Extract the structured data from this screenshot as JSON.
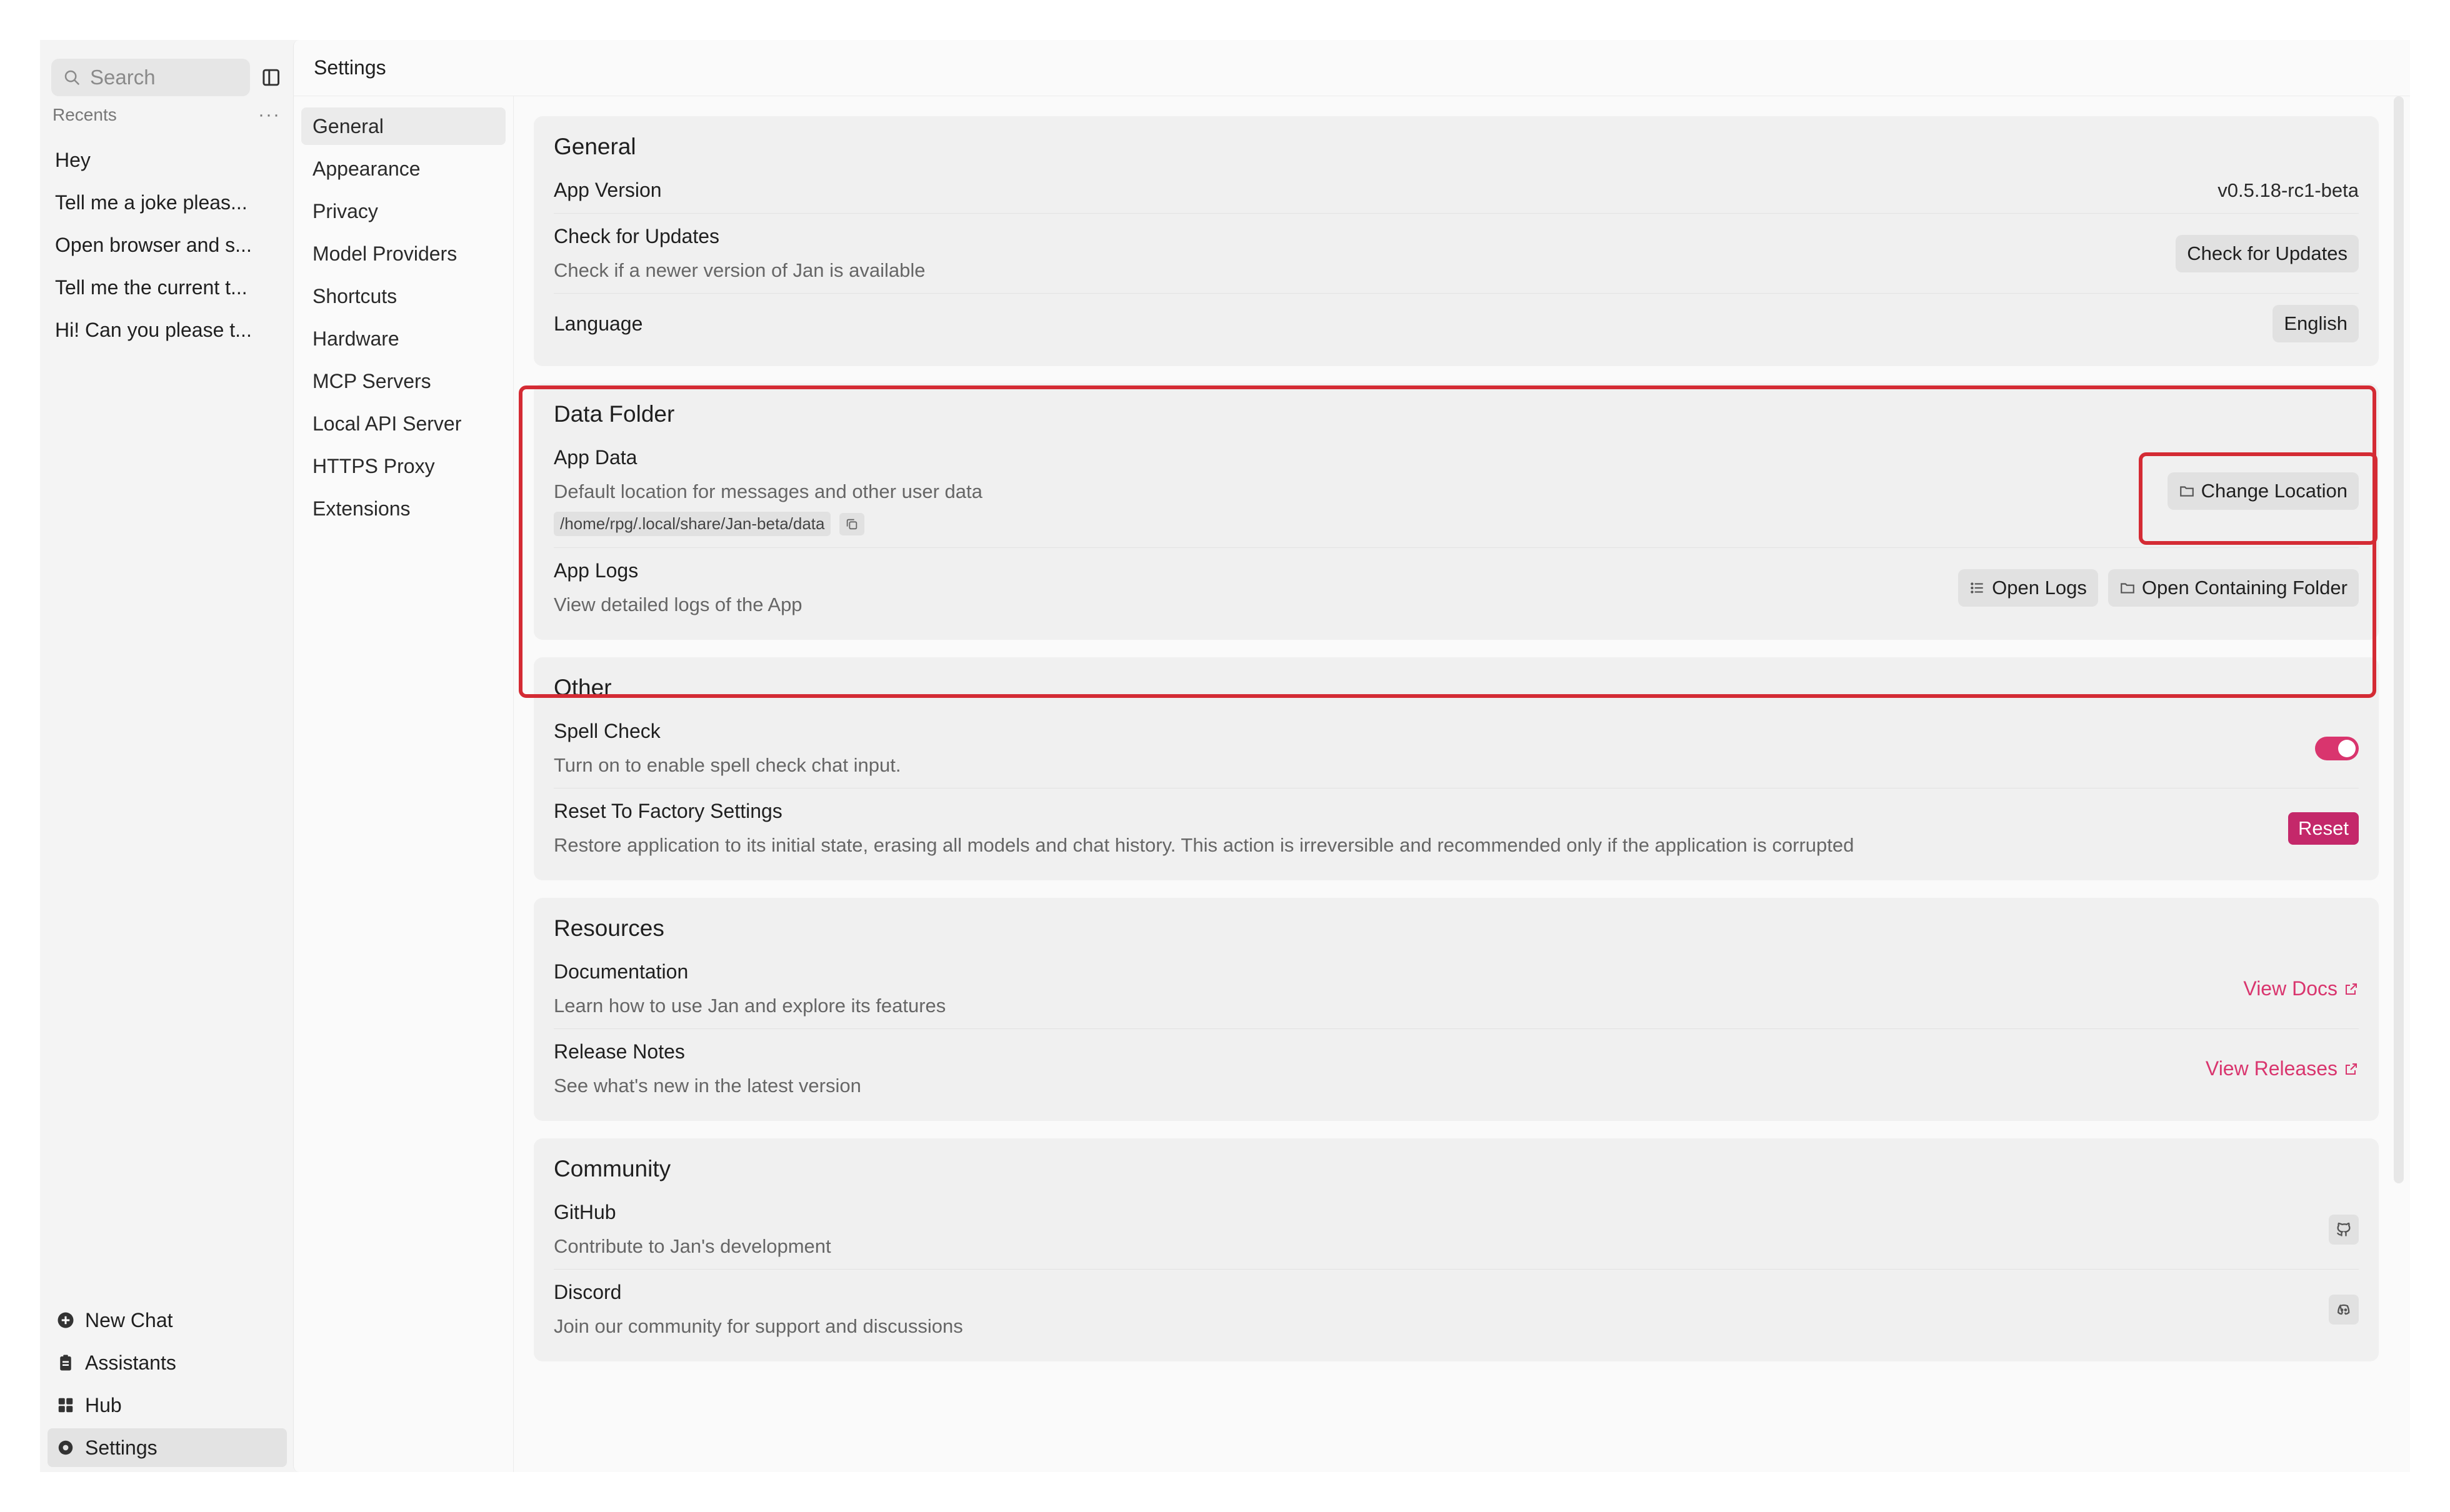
{
  "sidebar": {
    "search_placeholder": "Search",
    "recents_title": "Recents",
    "recents": [
      "Hey",
      "Tell me a joke pleas...",
      "Open browser and s...",
      "Tell me the current t...",
      "Hi! Can you please t..."
    ],
    "nav": {
      "new_chat": "New Chat",
      "assistants": "Assistants",
      "hub": "Hub",
      "settings": "Settings"
    }
  },
  "header": {
    "title": "Settings"
  },
  "settings_nav": [
    "General",
    "Appearance",
    "Privacy",
    "Model Providers",
    "Shortcuts",
    "Hardware",
    "MCP Servers",
    "Local API Server",
    "HTTPS Proxy",
    "Extensions"
  ],
  "general": {
    "title": "General",
    "app_version_label": "App Version",
    "app_version_value": "v0.5.18-rc1-beta",
    "updates_label": "Check for Updates",
    "updates_desc": "Check if a newer version of Jan is available",
    "updates_button": "Check for Updates",
    "language_label": "Language",
    "language_value": "English"
  },
  "data_folder": {
    "title": "Data Folder",
    "app_data_label": "App Data",
    "app_data_desc": "Default location for messages and other user data",
    "app_data_path": "/home/rpg/.local/share/Jan-beta/data",
    "change_location_button": "Change Location",
    "app_logs_label": "App Logs",
    "app_logs_desc": "View detailed logs of the App",
    "open_logs_button": "Open Logs",
    "open_folder_button": "Open Containing Folder"
  },
  "other": {
    "title": "Other",
    "spell_label": "Spell Check",
    "spell_desc": "Turn on to enable spell check chat input.",
    "spell_enabled": true,
    "reset_label": "Reset To Factory Settings",
    "reset_desc": "Restore application to its initial state, erasing all models and chat history. This action is irreversible and recommended only if the application is corrupted",
    "reset_button": "Reset"
  },
  "resources": {
    "title": "Resources",
    "docs_label": "Documentation",
    "docs_desc": "Learn how to use Jan and explore its features",
    "docs_link": "View Docs",
    "release_label": "Release Notes",
    "release_desc": "See what's new in the latest version",
    "release_link": "View Releases"
  },
  "community": {
    "title": "Community",
    "github_label": "GitHub",
    "github_desc": "Contribute to Jan's development",
    "discord_label": "Discord",
    "discord_desc": "Join our community for support and discussions"
  },
  "colors": {
    "accent": "#d9356e",
    "highlight": "#d42b34",
    "danger": "#c4286a"
  }
}
